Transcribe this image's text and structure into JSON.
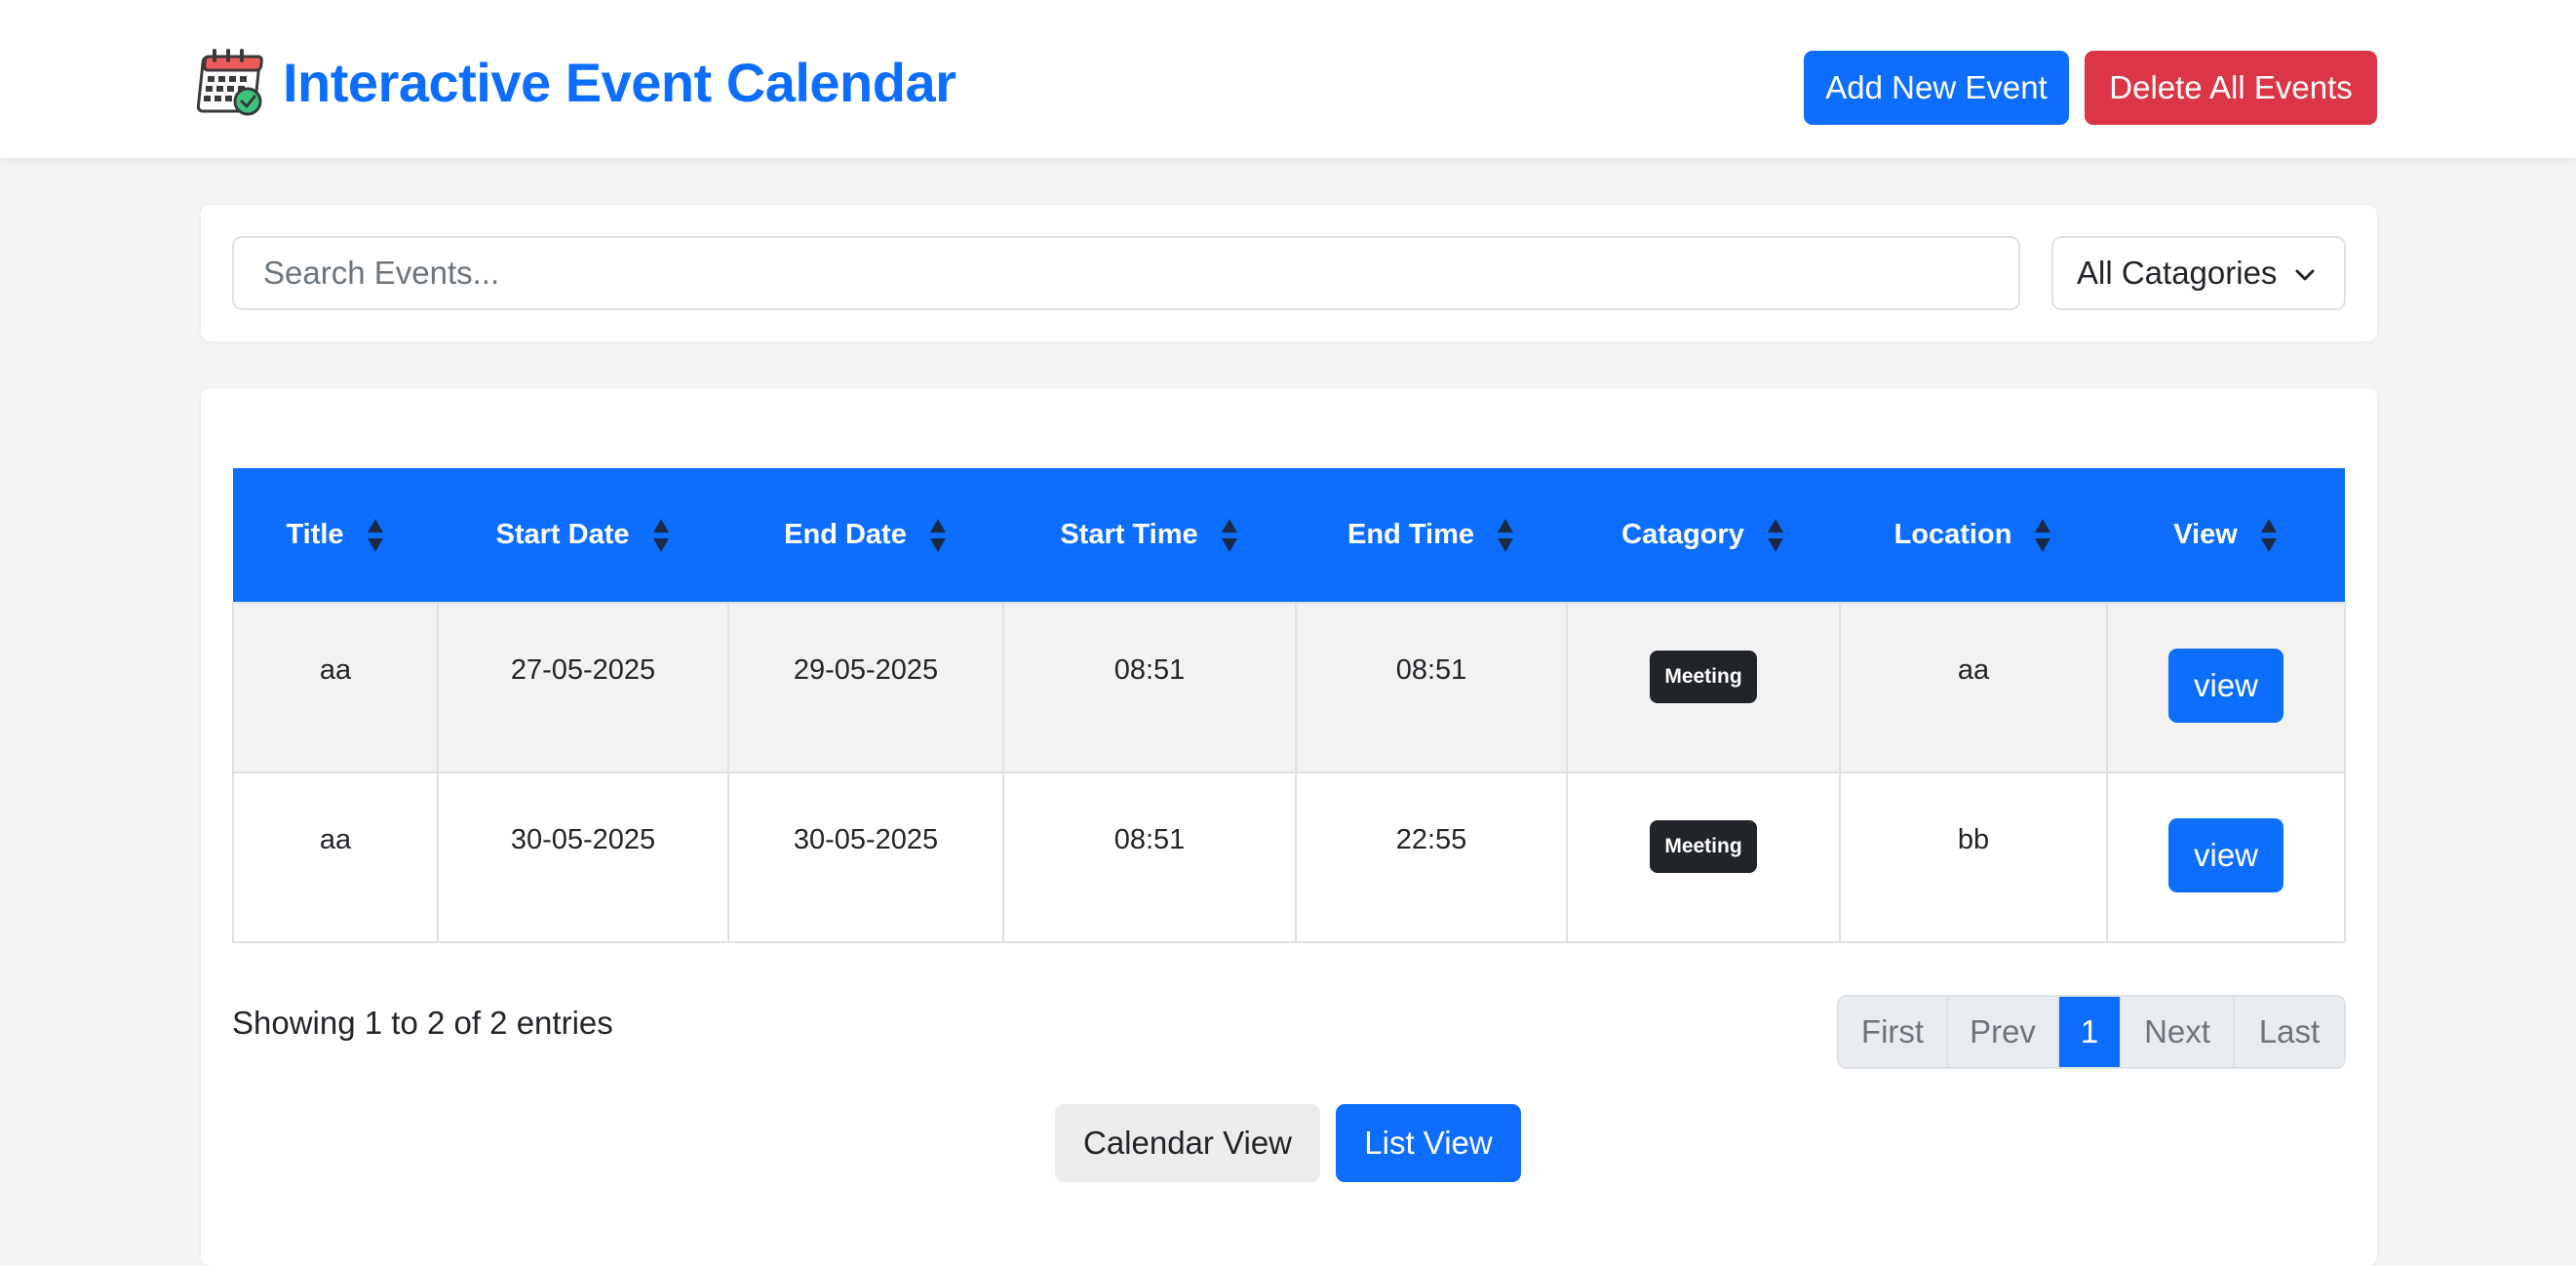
{
  "header": {
    "title": "Interactive Event Calendar",
    "add_button": "Add New Event",
    "delete_button": "Delete All Events"
  },
  "filters": {
    "search_placeholder": "Search Events...",
    "search_value": "",
    "category_selected": "All Catagories"
  },
  "table": {
    "columns": [
      "Title",
      "Start Date",
      "End Date",
      "Start Time",
      "End Time",
      "Catagory",
      "Location",
      "View"
    ],
    "rows": [
      {
        "title": "aa",
        "start_date": "27-05-2025",
        "end_date": "29-05-2025",
        "start_time": "08:51",
        "end_time": "08:51",
        "category": "Meeting",
        "location": "aa",
        "view": "view"
      },
      {
        "title": "aa",
        "start_date": "30-05-2025",
        "end_date": "30-05-2025",
        "start_time": "08:51",
        "end_time": "22:55",
        "category": "Meeting",
        "location": "bb",
        "view": "view"
      }
    ]
  },
  "footer": {
    "entries_text": "Showing 1 to 2 of 2 entries",
    "pagination": [
      "First",
      "Prev",
      "1",
      "Next",
      "Last"
    ],
    "active_page": "1",
    "calendar_view": "Calendar View",
    "list_view": "List View"
  },
  "colors": {
    "primary": "#0d6efd",
    "danger": "#dc3545",
    "badge": "#212529",
    "background": "#f3f4f6"
  }
}
